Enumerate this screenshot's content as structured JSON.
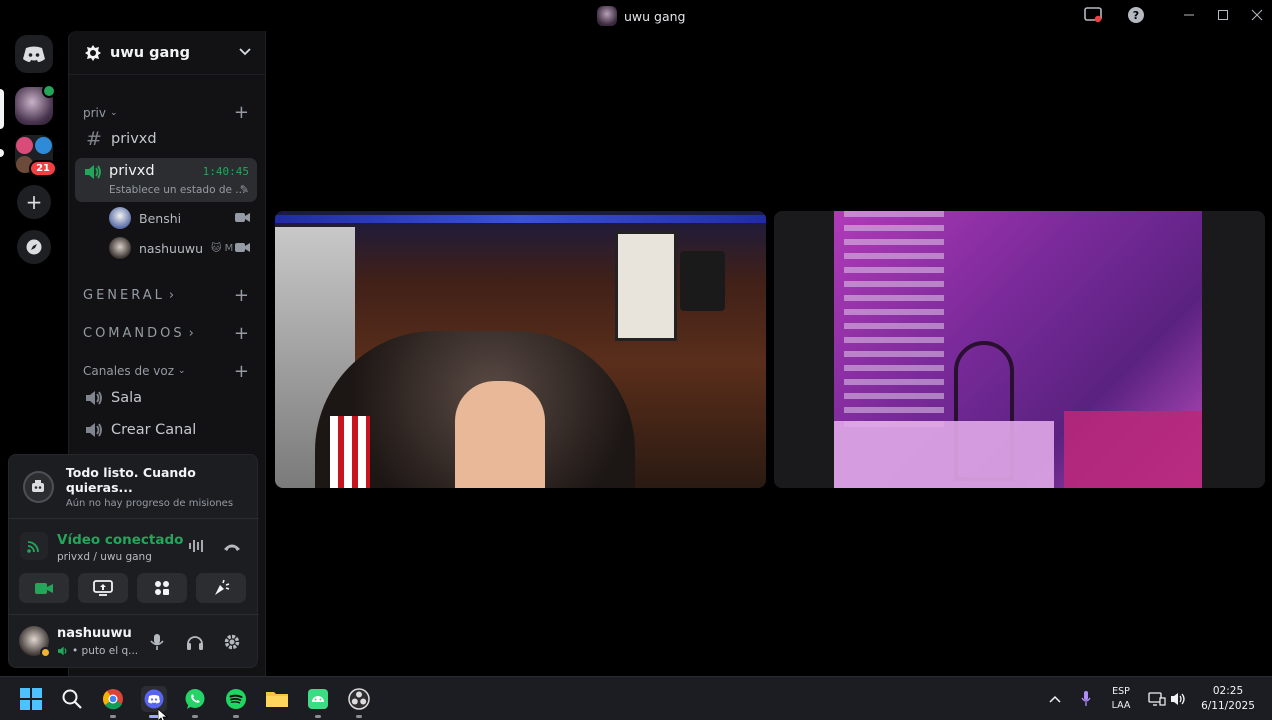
{
  "window": {
    "title": "uwu gang"
  },
  "server": {
    "name": "uwu gang",
    "mention_badge": "21"
  },
  "categories": {
    "priv": "priv",
    "general": "GENERAL",
    "comandos": "COMANDOS",
    "voz": "Canales de voz"
  },
  "channels": {
    "text_privxd": "privxd",
    "voice_privxd": {
      "name": "privxd",
      "timer": "1:40:45",
      "status": "Establece un estado de ..."
    },
    "sala": "Sala",
    "crear": "Crear Canal"
  },
  "voice_users": [
    {
      "name": "Benshi"
    },
    {
      "name": "nashuuwu",
      "tag": "🐱 M"
    }
  ],
  "quest": {
    "title": "Todo listo. Cuando quieras...",
    "subtitle": "Aún no hay progreso de misiones"
  },
  "voice_status": {
    "label": "Vídeo conectado",
    "location": "privxd / uwu gang"
  },
  "user": {
    "name": "nashuuwu",
    "status": "• puto el q..."
  },
  "taskbar": {
    "lang": "ESP",
    "layout": "LAA",
    "time": "02:25",
    "date": "6/11/2025"
  },
  "colors": {
    "green": "#23a55a",
    "accent": "#5865f2",
    "danger": "#f23f43"
  },
  "icons": [
    "discord-icon",
    "hash-icon",
    "speaker-icon",
    "camera-icon",
    "gear-icon",
    "microphone-icon",
    "headphones-icon",
    "hangup-icon",
    "screen-share-icon",
    "activities-icon",
    "soundboard-icon",
    "windows-start-icon",
    "search-icon",
    "chrome-icon",
    "whatsapp-icon",
    "spotify-icon",
    "folder-icon",
    "obs-icon"
  ]
}
